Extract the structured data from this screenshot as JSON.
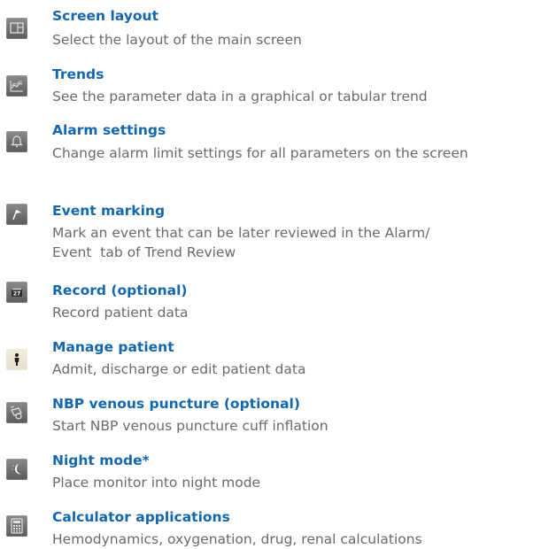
{
  "items": [
    {
      "icon": "screen-layout-icon",
      "title": "Screen layout",
      "description": "Select the layout of the main screen"
    },
    {
      "icon": "trends-icon",
      "title": "Trends",
      "description": "See the parameter data in a graphical or tabular trend"
    },
    {
      "icon": "alarm-bell-icon",
      "title": "Alarm settings",
      "description": "Change alarm limit settings for all parameters on the screen"
    },
    {
      "icon": "event-flag-icon",
      "title": "Event marking",
      "description": "Mark an event that can be later reviewed in the Alarm/\nEvent  tab of Trend Review"
    },
    {
      "icon": "record-icon",
      "title": "Record (optional)",
      "description": "Record patient data"
    },
    {
      "icon": "patient-person-icon",
      "title": "Manage patient",
      "description": "Admit, discharge or edit patient data"
    },
    {
      "icon": "nbp-cuff-icon",
      "title": "NBP venous puncture (optional)",
      "description": "Start NBP venous puncture cuff inflation"
    },
    {
      "icon": "night-mode-moon-icon",
      "title": "Night mode*",
      "description": "Place monitor into night mode"
    },
    {
      "icon": "calculator-icon",
      "title": "Calculator applications",
      "description": "Hemodynamics, oxygenation, drug, renal calculations"
    }
  ]
}
